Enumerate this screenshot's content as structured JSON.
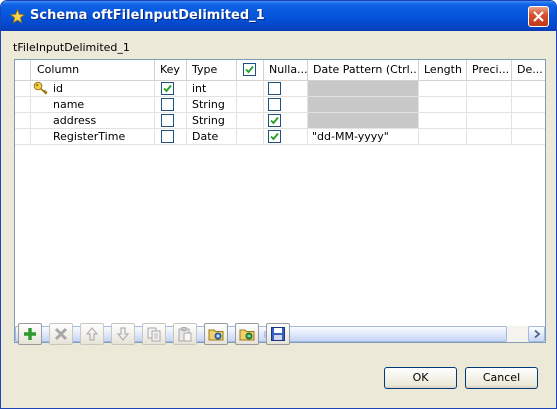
{
  "window": {
    "title": "Schema oftFileInputDelimited_1",
    "title_icon": "star-icon",
    "close_icon": "close-icon"
  },
  "subtitle": "tFileInputDelimited_1",
  "table": {
    "headers": {
      "column": "Column",
      "key": "Key",
      "type": "Type",
      "nullable": "Nulla...",
      "date_pattern": "Date Pattern (Ctrl...",
      "length": "Length",
      "precision": "Preci...",
      "default": "De..."
    },
    "header_check_all": true,
    "rows": [
      {
        "column": "id",
        "key": true,
        "type": "int",
        "nullable": false,
        "date_pattern": "",
        "pattern_disabled": true,
        "is_key_icon": "key-icon"
      },
      {
        "column": "name",
        "key": false,
        "type": "String",
        "nullable": false,
        "date_pattern": "",
        "pattern_disabled": true
      },
      {
        "column": "address",
        "key": false,
        "type": "String",
        "nullable": true,
        "date_pattern": "",
        "pattern_disabled": true
      },
      {
        "column": "RegisterTime",
        "key": false,
        "type": "Date",
        "nullable": true,
        "date_pattern": "\"dd-MM-yyyy\"",
        "pattern_disabled": false
      }
    ]
  },
  "toolbar": [
    {
      "name": "add-button",
      "icon": "plus-icon",
      "enabled": true
    },
    {
      "name": "remove-button",
      "icon": "delete-icon",
      "enabled": false
    },
    {
      "name": "move-up-button",
      "icon": "arrow-up-icon",
      "enabled": false
    },
    {
      "name": "move-down-button",
      "icon": "arrow-down-icon",
      "enabled": false
    },
    {
      "name": "copy-button",
      "icon": "copy-icon",
      "enabled": false
    },
    {
      "name": "paste-button",
      "icon": "paste-icon",
      "enabled": false
    },
    {
      "name": "import-button",
      "icon": "folder-import-icon",
      "enabled": true
    },
    {
      "name": "export-button",
      "icon": "folder-export-icon",
      "enabled": true
    },
    {
      "name": "save-button",
      "icon": "save-icon",
      "enabled": true
    }
  ],
  "buttons": {
    "ok": "OK",
    "cancel": "Cancel"
  },
  "colors": {
    "titlebar": "#0453d9",
    "check": "#21a121",
    "accent": "#003c74"
  }
}
